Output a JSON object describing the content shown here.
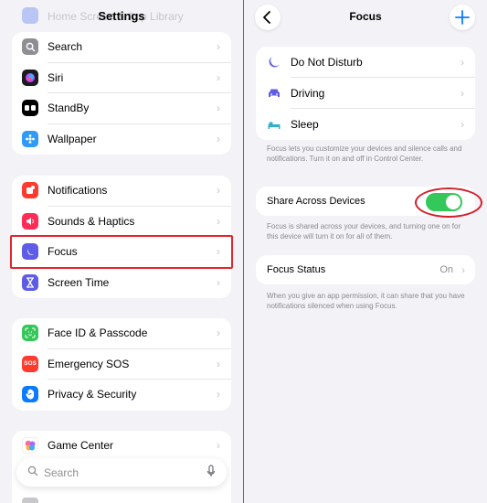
{
  "settings": {
    "title": "Settings",
    "ghost_label": "Home Screen & App Library",
    "groups": [
      {
        "items": [
          {
            "label": "Search",
            "icon": "search-icon",
            "color": "#8e8e93"
          },
          {
            "label": "Siri",
            "icon": "siri-icon",
            "color": "#1c1c1e"
          },
          {
            "label": "StandBy",
            "icon": "standby-icon",
            "color": "#000000"
          },
          {
            "label": "Wallpaper",
            "icon": "wallpaper-icon",
            "color": "#2f9bf5"
          }
        ]
      },
      {
        "items": [
          {
            "label": "Notifications",
            "icon": "notifications-icon",
            "color": "#ff3b30"
          },
          {
            "label": "Sounds & Haptics",
            "icon": "speaker-icon",
            "color": "#ff2d55"
          },
          {
            "label": "Focus",
            "icon": "moon-icon",
            "color": "#5e5ce6"
          },
          {
            "label": "Screen Time",
            "icon": "hourglass-icon",
            "color": "#5e5ce6"
          }
        ]
      },
      {
        "items": [
          {
            "label": "Face ID & Passcode",
            "icon": "face-id-icon",
            "color": "#34c759"
          },
          {
            "label": "Emergency SOS",
            "icon": "sos-icon",
            "color": "#ff3b30",
            "glyph": "SOS"
          },
          {
            "label": "Privacy & Security",
            "icon": "hand-icon",
            "color": "#0a7aff"
          }
        ]
      },
      {
        "items": [
          {
            "label": "Game Center",
            "icon": "game-center-icon",
            "color": "#ff6b9a"
          }
        ]
      }
    ],
    "search_placeholder": "Search"
  },
  "focus": {
    "title": "Focus",
    "modes": [
      {
        "label": "Do Not Disturb",
        "icon": "moon-icon",
        "color": "#5e5ce6"
      },
      {
        "label": "Driving",
        "icon": "car-icon",
        "color": "#5e5ce6"
      },
      {
        "label": "Sleep",
        "icon": "bed-icon",
        "color": "#30b0c7"
      }
    ],
    "modes_note": "Focus lets you customize your devices and silence calls and notifications. Turn it on and off in Control Center.",
    "share_label": "Share Across Devices",
    "share_enabled": true,
    "share_note": "Focus is shared across your devices, and turning one on for this device will turn it on for all of them.",
    "status_label": "Focus Status",
    "status_value": "On",
    "status_note": "When you give an app permission, it can share that you have notifications silenced when using Focus."
  },
  "colors": {
    "accent": "#0a7aff",
    "toggle_on": "#34c759",
    "annotation": "#e3262b"
  }
}
